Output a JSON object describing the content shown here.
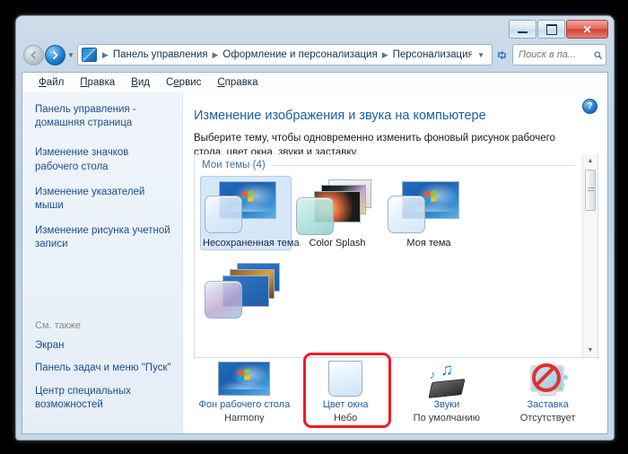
{
  "window": {
    "minimize_label": "Свернуть",
    "maximize_label": "Развернуть",
    "close_label": "✕"
  },
  "address_bar": {
    "back_label": "◀",
    "forward_label": "➜",
    "history_dropdown": "▼",
    "breadcrumbs": [
      "Панель управления",
      "Оформление и персонализация",
      "Персонализация"
    ],
    "separator": "▶",
    "dropdown_label": "▼",
    "refresh_label": "↻",
    "search_placeholder": "Поиск в па...",
    "search_value": "",
    "search_icon": "🔍"
  },
  "menubar": {
    "items": [
      {
        "accel": "Ф",
        "rest": "айл"
      },
      {
        "accel": "П",
        "rest": "равка"
      },
      {
        "accel": "В",
        "rest": "ид"
      },
      {
        "accel": "С",
        "rest": "ервис",
        "pre": "С",
        "mid": "е"
      },
      {
        "accel": "С",
        "rest": "правка"
      }
    ],
    "labels": [
      "Файл",
      "Правка",
      "Вид",
      "Сервис",
      "Справка"
    ]
  },
  "sidebar": {
    "links": [
      "Панель управления - домашняя страница",
      "Изменение значков рабочего стола",
      "Изменение указателей мыши",
      "Изменение рисунка учетной записи"
    ],
    "see_also_title": "См. также",
    "see_also_links": [
      "Экран",
      "Панель задач и меню \"Пуск\"",
      "Центр специальных возможностей"
    ]
  },
  "main": {
    "help_label": "?",
    "heading": "Изменение изображения и звука на компьютере",
    "subtitle": "Выберите тему, чтобы одновременно изменить фоновый рисунок рабочего стола, цвет окна, звуки и заставку.",
    "group_label": "Мои темы (4)",
    "themes": [
      {
        "name": "Несохраненная тема",
        "selected": true
      },
      {
        "name": "Color Splash",
        "selected": false
      },
      {
        "name": "Моя тема",
        "selected": false
      },
      {
        "name": "",
        "selected": false
      }
    ],
    "scroll_up": "▲",
    "scroll_down": "▼"
  },
  "bottom_items": [
    {
      "label": "Фон рабочего стола",
      "value": "Harmony",
      "icon": "wallpaper-icon",
      "highlighted": false
    },
    {
      "label": "Цвет окна",
      "value": "Небо",
      "icon": "window-color-icon",
      "highlighted": true
    },
    {
      "label": "Звуки",
      "value": "По умолчанию",
      "icon": "sounds-icon",
      "highlighted": false
    },
    {
      "label": "Заставка",
      "value": "Отсутствует",
      "icon": "screensaver-icon",
      "highlighted": false
    }
  ],
  "colors": {
    "accent": "#1b5fa8",
    "highlight_ring": "#ee1c25",
    "selected_theme_bg": "#d6e7f8",
    "frame": "#c6d7e6"
  }
}
